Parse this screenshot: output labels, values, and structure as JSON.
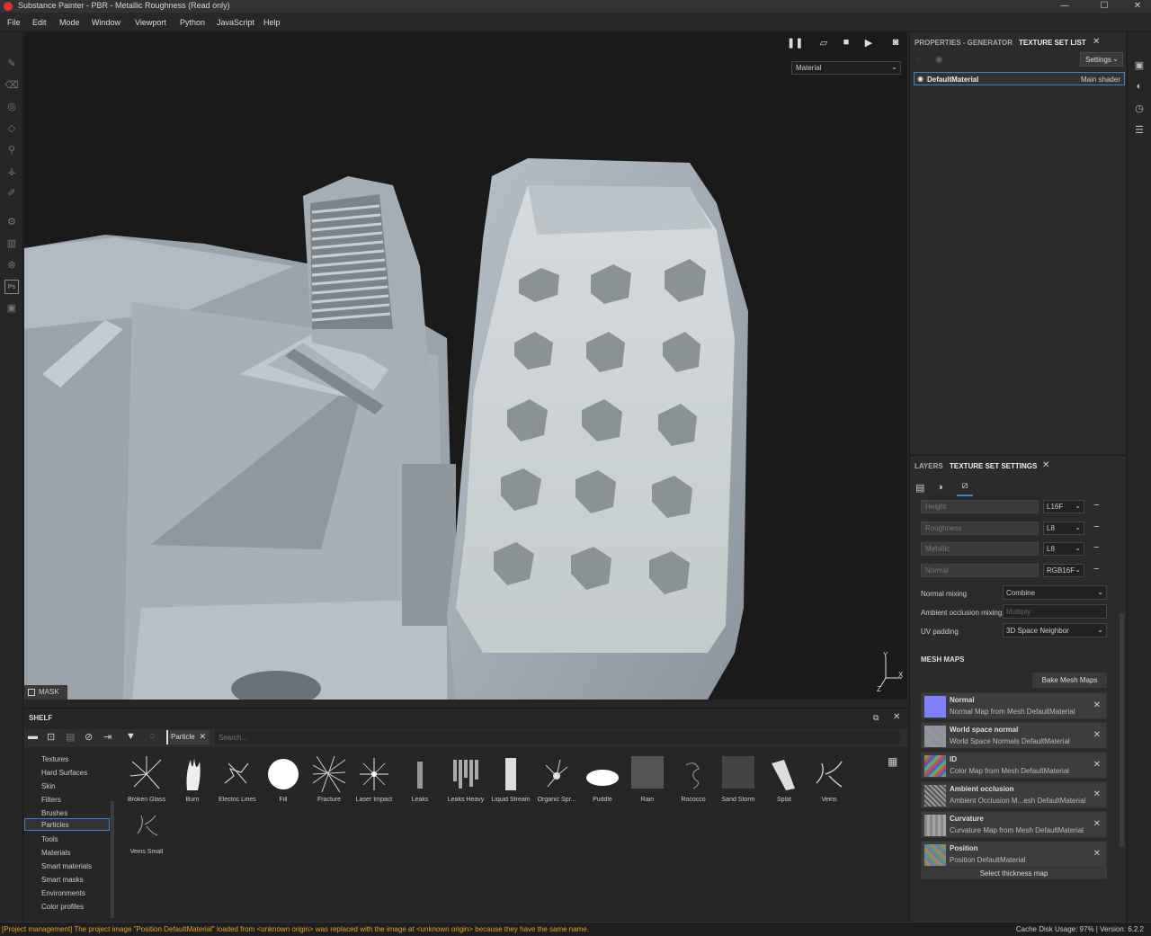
{
  "window": {
    "title": "Substance Painter - PBR - Metallic Roughness (Read only)",
    "controls": [
      "—",
      "☐",
      "✕"
    ]
  },
  "menu": [
    "File",
    "Edit",
    "Mode",
    "Window",
    "Viewport",
    "Python",
    "JavaScript",
    "Help"
  ],
  "viewport": {
    "material_mode": "Material",
    "mask_label": "MASK",
    "axis": {
      "y": "Y",
      "x": "X",
      "z": "Z"
    }
  },
  "right_panel": {
    "tabs": [
      "PROPERTIES - GENERATOR",
      "TEXTURE SET LIST"
    ],
    "settings_label": "Settings",
    "texture_sets": [
      {
        "name": "DefaultMaterial",
        "shader": "Main shader"
      }
    ]
  },
  "layers_panel": {
    "tabs": [
      "LAYERS",
      "TEXTURE SET SETTINGS"
    ],
    "channels": [
      {
        "name": "Height",
        "format": "L16F"
      },
      {
        "name": "Roughness",
        "format": "L8"
      },
      {
        "name": "Metallic",
        "format": "L8"
      },
      {
        "name": "Normal",
        "format": "RGB16F"
      }
    ],
    "normal_mixing": {
      "label": "Normal mixing",
      "value": "Combine"
    },
    "ao_mixing": {
      "label": "Ambient occlusion mixing",
      "value": "Multiply"
    },
    "uv_padding": {
      "label": "UV padding",
      "value": "3D Space Neighbor"
    },
    "mesh_maps_title": "MESH MAPS",
    "bake_label": "Bake Mesh Maps",
    "mesh_maps": [
      {
        "name": "Normal",
        "source": "Normal Map from Mesh DefaultMaterial",
        "color": "#7f7ff8"
      },
      {
        "name": "World space normal",
        "source": "World Space Normals DefaultMaterial",
        "color": "#8a9a8a"
      },
      {
        "name": "ID",
        "source": "Color Map from Mesh DefaultMaterial",
        "color": "#6aa06a"
      },
      {
        "name": "Ambient occlusion",
        "source": "Ambient Occlusion M...esh DefaultMaterial",
        "color": "#9a9a9a"
      },
      {
        "name": "Curvature",
        "source": "Curvature Map from Mesh DefaultMaterial",
        "color": "#888888"
      },
      {
        "name": "Position",
        "source": "Position DefaultMaterial",
        "color": "#5a9a6a"
      }
    ],
    "thickness_label": "Select thickness map"
  },
  "shelf": {
    "title": "SHELF",
    "filter_chip": "Particle",
    "search_placeholder": "Search...",
    "categories": [
      "Textures",
      "Hard Surfaces",
      "Skin",
      "Filters",
      "Brushes",
      "Particles",
      "Tools",
      "Materials",
      "Smart materials",
      "Smart masks",
      "Environments",
      "Color profiles"
    ],
    "active_category": "Particles",
    "items": [
      "Broken Glass",
      "Burn",
      "Electric Lines",
      "Fill",
      "Fracture",
      "Laser Impact",
      "Leaks",
      "Leaks Heavy",
      "Liquid Stream",
      "Organic Spr...",
      "Puddle",
      "Rain",
      "Rococco",
      "Sand Storm",
      "Splat",
      "Veins",
      "Veins Small"
    ]
  },
  "status": {
    "message": "[Project management] The project image \"Position DefaultMaterial\" loaded from <unknown origin> was replaced with the image at <unknown origin> because they have the same name.",
    "cache": "Cache Disk Usage:   97% | Version: 6.2.2"
  }
}
